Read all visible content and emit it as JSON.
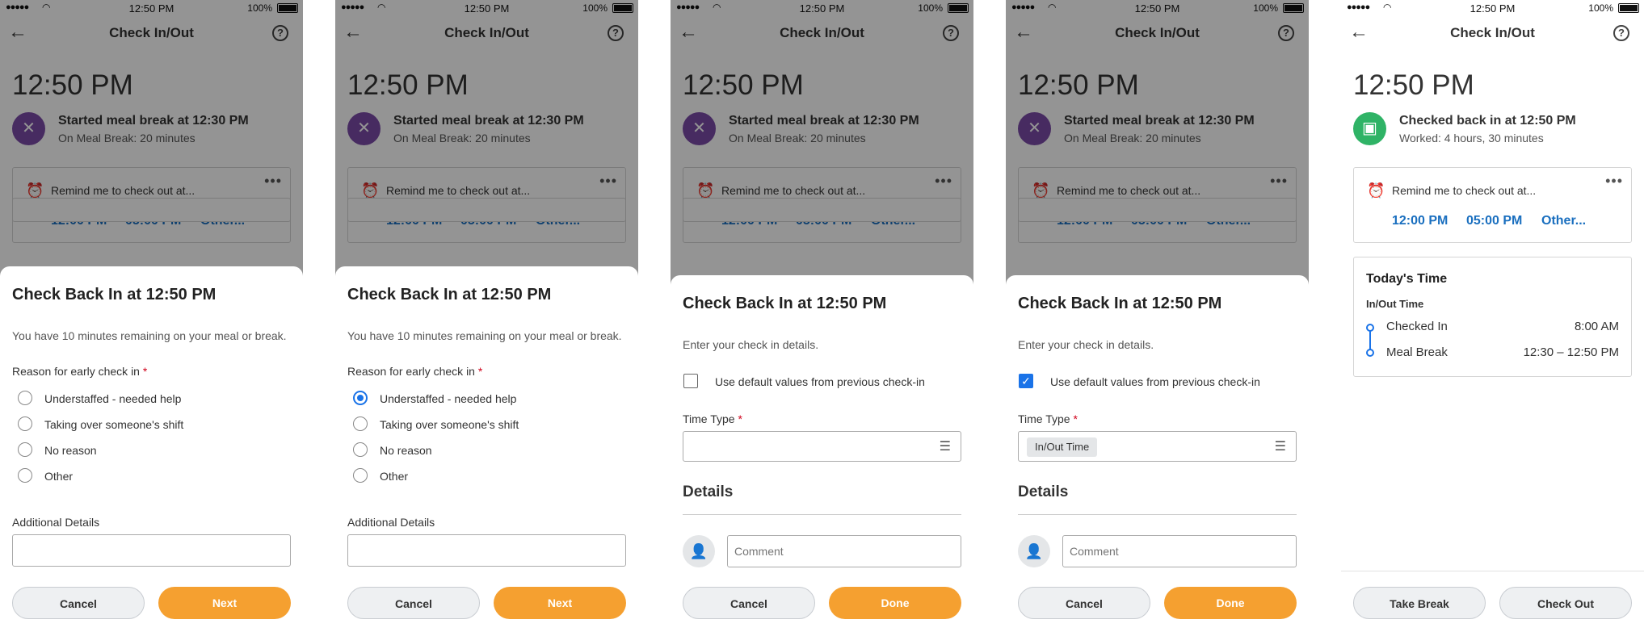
{
  "status_bar": {
    "signal": "●●●●●",
    "wifi": "wifi",
    "time": "12:50 PM",
    "battery": "100%"
  },
  "nav": {
    "title": "Check In/Out",
    "back_icon": "←",
    "help_icon": "?"
  },
  "current_time": "12:50 PM",
  "meal_status": {
    "title": "Started meal break at 12:30 PM",
    "subtitle": "On Meal Break: 20 minutes",
    "icon": "fork-knife-icon",
    "color": "#7b4ba8"
  },
  "checkin_status": {
    "title": "Checked back in at 12:50 PM",
    "subtitle": "Worked: 4 hours, 30 minutes",
    "icon": "calendar-icon",
    "color": "#2fb366"
  },
  "reminder": {
    "text": "Remind me to check out at...",
    "options": [
      "12:00 PM",
      "05:00 PM",
      "Other..."
    ],
    "more": "•••"
  },
  "early_sheet": {
    "title": "Check Back In at 12:50 PM",
    "subtitle": "You have 10 minutes remaining on your meal or break.",
    "reason_label": "Reason for early check in",
    "required": "*",
    "reasons": [
      "Understaffed - needed help",
      "Taking over someone's shift",
      "No reason",
      "Other"
    ],
    "details_label": "Additional Details",
    "cancel": "Cancel",
    "next": "Next"
  },
  "details_sheet": {
    "title": "Check Back In at 12:50 PM",
    "subtitle": "Enter your check in details.",
    "checkbox_label": "Use default values from previous check-in",
    "time_type_label": "Time Type",
    "required": "*",
    "time_type_value": "In/Out Time",
    "details_title": "Details",
    "comment_placeholder": "Comment",
    "cancel": "Cancel",
    "done": "Done"
  },
  "today_card": {
    "title": "Today's Time",
    "subtitle": "In/Out Time",
    "rows": [
      {
        "label": "Checked In",
        "value": "8:00 AM"
      },
      {
        "label": "Meal Break",
        "value": "12:30 – 12:50 PM"
      }
    ]
  },
  "footer": {
    "take_break": "Take Break",
    "check_out": "Check Out"
  },
  "colors": {
    "accent_blue": "#1a6fbf",
    "primary_orange": "#f5a030",
    "required_red": "#d0021b"
  }
}
